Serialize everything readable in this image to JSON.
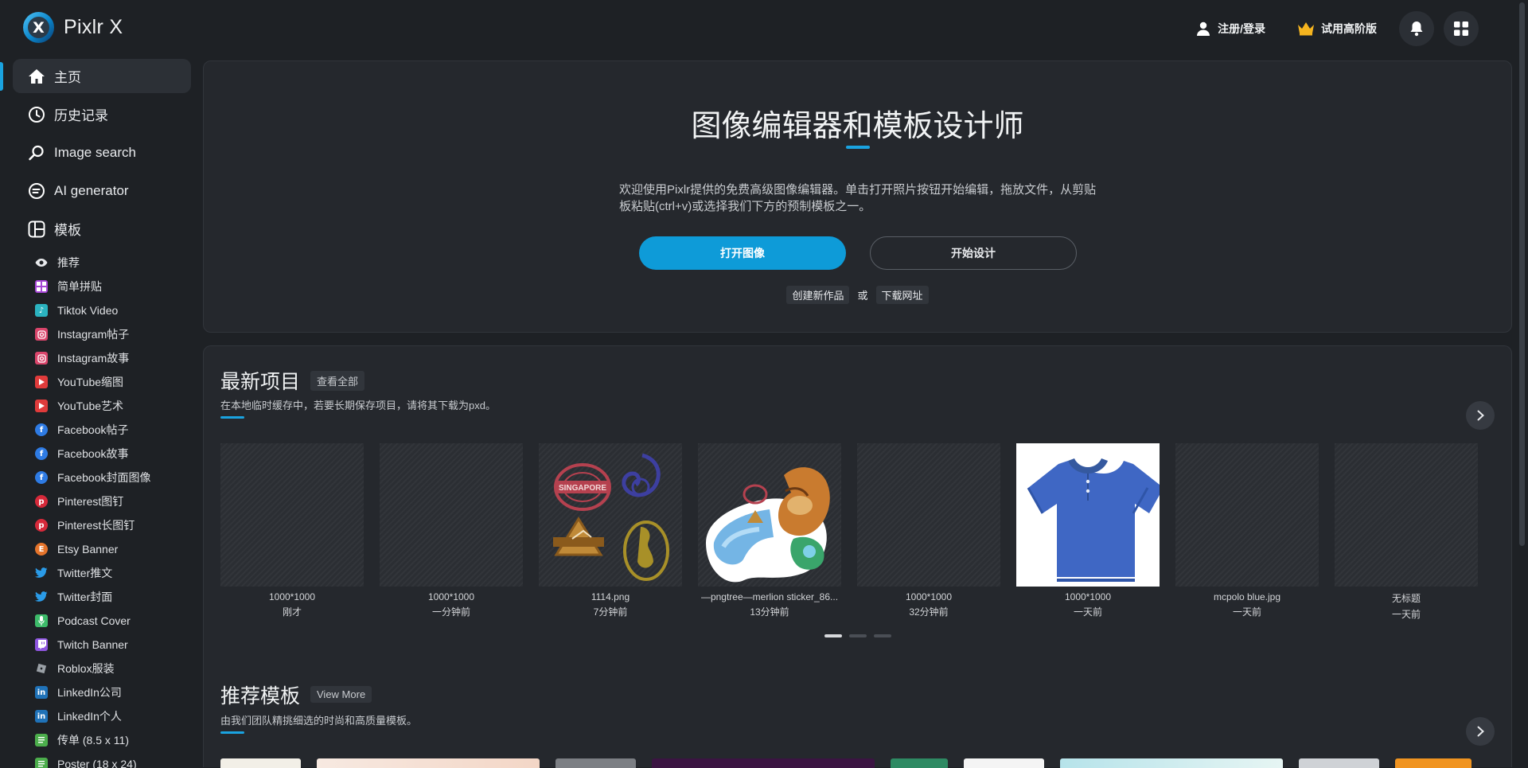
{
  "app": {
    "name": "Pixlr X"
  },
  "header": {
    "login_label": "注册/登录",
    "premium_label": "试用高阶版",
    "accent_color": "#1aa3e0"
  },
  "sidebar": {
    "main": [
      {
        "label": "主页",
        "icon": "home-icon",
        "active": true
      },
      {
        "label": "历史记录",
        "icon": "history-icon"
      },
      {
        "label": "Image search",
        "icon": "search-icon"
      },
      {
        "label": "AI generator",
        "icon": "ai-generator-icon"
      },
      {
        "label": "模板",
        "icon": "template-icon"
      }
    ],
    "templates": [
      {
        "label": "推荐",
        "icon": "eye-icon",
        "color": "#1e2125"
      },
      {
        "label": "简单拼贴",
        "icon": "collage-icon",
        "color": "#a646d6"
      },
      {
        "label": "Tiktok Video",
        "icon": "tiktok-icon",
        "color": "#2bb3c0"
      },
      {
        "label": "Instagram帖子",
        "icon": "instagram-icon",
        "color": "#d9456b"
      },
      {
        "label": "Instagram故事",
        "icon": "instagram-icon",
        "color": "#d9456b"
      },
      {
        "label": "YouTube缩图",
        "icon": "youtube-icon",
        "color": "#e03b3b"
      },
      {
        "label": "YouTube艺术",
        "icon": "youtube-icon",
        "color": "#e03b3b"
      },
      {
        "label": "Facebook帖子",
        "icon": "facebook-icon",
        "color": "#2e7be4"
      },
      {
        "label": "Facebook故事",
        "icon": "facebook-icon",
        "color": "#2e7be4"
      },
      {
        "label": "Facebook封面图像",
        "icon": "facebook-icon",
        "color": "#2e7be4"
      },
      {
        "label": "Pinterest图钉",
        "icon": "pinterest-icon",
        "color": "#d6293a"
      },
      {
        "label": "Pinterest长图钉",
        "icon": "pinterest-icon",
        "color": "#d6293a"
      },
      {
        "label": "Etsy Banner",
        "icon": "etsy-icon",
        "color": "#e5742b"
      },
      {
        "label": "Twitter推文",
        "icon": "twitter-icon",
        "color": "#2a9be8"
      },
      {
        "label": "Twitter封面",
        "icon": "twitter-icon",
        "color": "#2a9be8"
      },
      {
        "label": "Podcast Cover",
        "icon": "microphone-icon",
        "color": "#3dbb6a"
      },
      {
        "label": "Twitch Banner",
        "icon": "twitch-icon",
        "color": "#8f56e0"
      },
      {
        "label": "Roblox服装",
        "icon": "roblox-icon",
        "color": "#9aa0a6"
      },
      {
        "label": "LinkedIn公司",
        "icon": "linkedin-icon",
        "color": "#1f72b8"
      },
      {
        "label": "LinkedIn个人",
        "icon": "linkedin-icon",
        "color": "#1f72b8"
      },
      {
        "label": "传单 (8.5 x 11)",
        "icon": "flyer-icon",
        "color": "#4cae4c"
      },
      {
        "label": "Poster (18 x 24)",
        "icon": "poster-icon",
        "color": "#4cae4c"
      }
    ]
  },
  "hero": {
    "title": "图像编辑器和模板设计师",
    "description": "欢迎使用Pixlr提供的免费高级图像编辑器。单击打开照片按钮开始编辑，拖放文件，从剪贴板粘贴(ctrl+v)或选择我们下方的预制模板之一。",
    "open_image_label": "打开图像",
    "start_design_label": "开始设计",
    "create_new_label": "创建新作品",
    "or_label": "或",
    "download_url_label": "下载网址"
  },
  "recent": {
    "title": "最新项目",
    "view_all_label": "查看全部",
    "subtitle": "在本地临时缓存中，若要长期保存项目，请将其下载为pxd。",
    "items": [
      {
        "name": "1000*1000",
        "time": "刚才",
        "thumb": "blank"
      },
      {
        "name": "1000*1000",
        "time": "一分钟前",
        "thumb": "blank"
      },
      {
        "name": "1114.png",
        "time": "7分钟前",
        "thumb": "stamps",
        "stamp_text": "SINGAPORE"
      },
      {
        "name": "—pngtree—merlion sticker_86...",
        "time": "13分钟前",
        "thumb": "merlion"
      },
      {
        "name": "1000*1000",
        "time": "32分钟前",
        "thumb": "blank"
      },
      {
        "name": "1000*1000",
        "time": "一天前",
        "thumb": "shirt"
      },
      {
        "name": "mcpolo blue.jpg",
        "time": "一天前",
        "thumb": "blank"
      },
      {
        "name": "无标题",
        "time": "一天前",
        "thumb": "blank"
      }
    ],
    "pager_pages": 3,
    "pager_current": 1
  },
  "templates_section": {
    "title": "推荐模板",
    "view_more_label": "View More",
    "subtitle": "由我们团队精挑细选的时尚和高质量模板。"
  }
}
